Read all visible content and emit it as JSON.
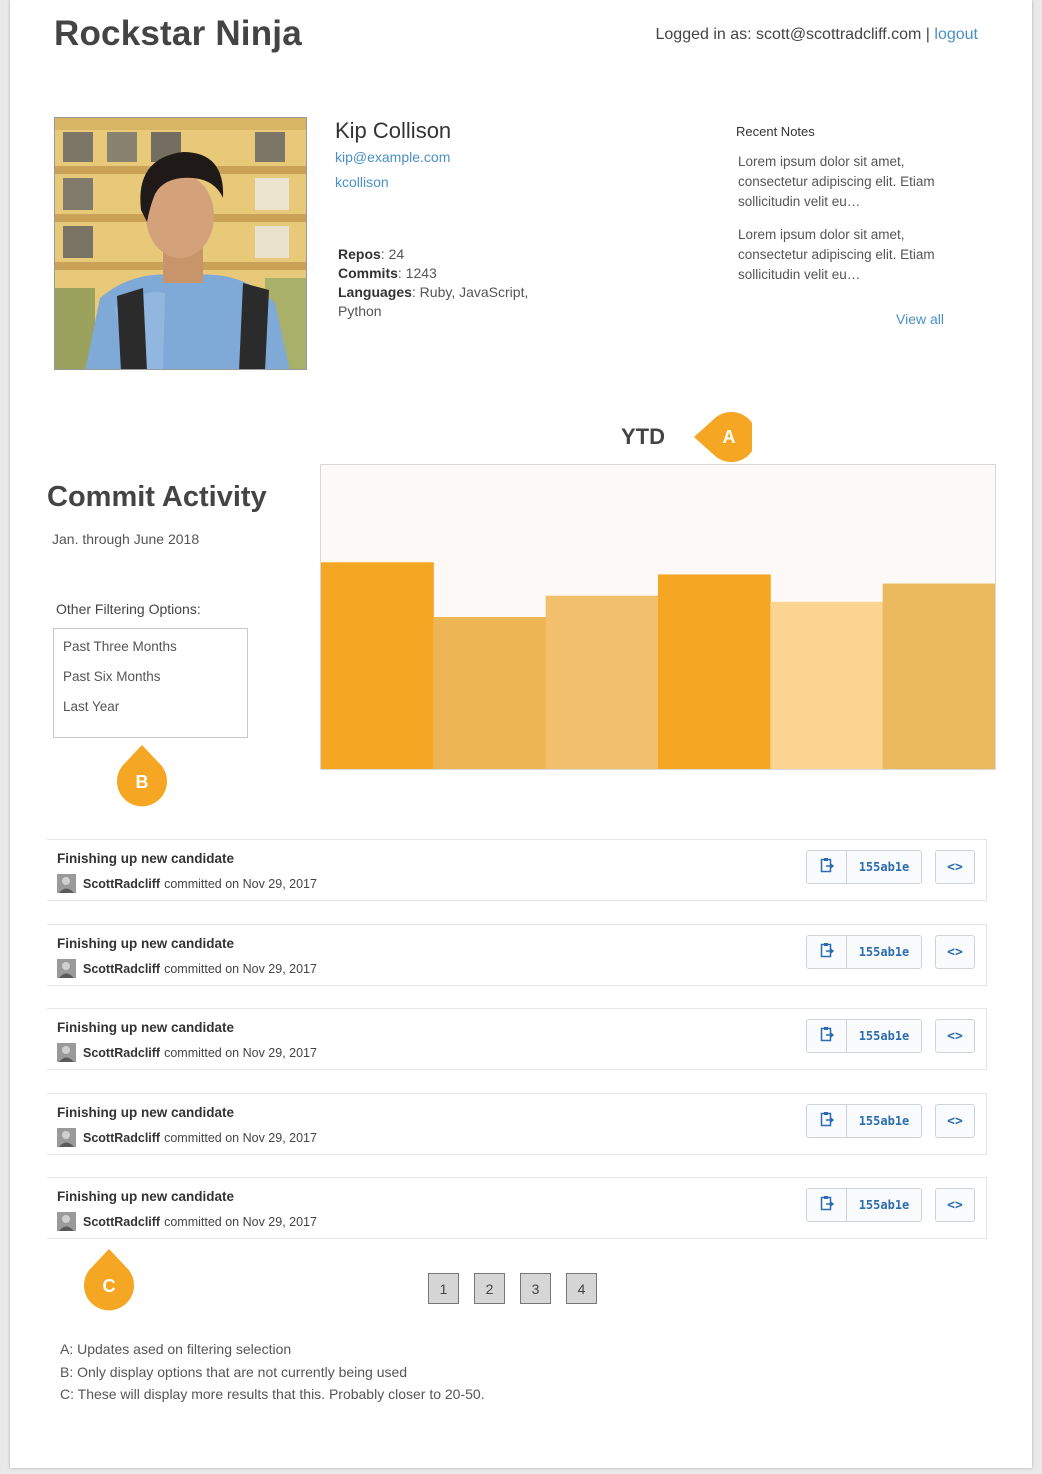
{
  "app": {
    "title": "Rockstar Ninja",
    "login_prefix": "Logged in as: scott@scottradcliff.com | ",
    "logout_label": "logout"
  },
  "profile": {
    "name": "Kip Collison",
    "email": "kip@example.com",
    "username": "kcollison",
    "repos_label": "Repos",
    "repos_value": ": 24",
    "commits_label": "Commits",
    "commits_value": ": 1243",
    "languages_label": "Languages",
    "languages_value": ": Ruby, JavaScript, Python"
  },
  "notes": {
    "title": "Recent Notes",
    "items": [
      "Lorem ipsum dolor sit amet, consectetur adipiscing elit. Etiam sollicitudin velit eu…",
      "Lorem ipsum dolor sit amet, consectetur adipiscing elit. Etiam sollicitudin velit eu…"
    ],
    "view_all_label": "View all"
  },
  "annotations": {
    "ytd_label": "YTD",
    "a": "A",
    "b": "B",
    "c": "C"
  },
  "activity": {
    "title": "Commit Activity",
    "subtitle": "Jan. through June 2018",
    "filter_title": "Other Filtering Options:",
    "filter_options": [
      "Past Three Months",
      "Past Six Months",
      "Last Year"
    ]
  },
  "chart_data": {
    "type": "bar",
    "title": "",
    "xlabel": "",
    "ylabel": "",
    "ylim": [
      0,
      100
    ],
    "grid": false,
    "categories": [
      "",
      "",
      "",
      "",
      "",
      ""
    ],
    "values": [
      68,
      50,
      57,
      64,
      55,
      61
    ],
    "colors": [
      "#f5a623",
      "#eeb554",
      "#f2c06c",
      "#f5a623",
      "#fcd491",
      "#ecba5e"
    ]
  },
  "commits": [
    {
      "title": "Finishing up new candidate",
      "author": "ScottRadcliff",
      "meta": "committed on Nov 29, 2017",
      "sha": "155ab1e",
      "browse": "<>"
    },
    {
      "title": "Finishing up new candidate",
      "author": "ScottRadcliff",
      "meta": "committed on Nov 29, 2017",
      "sha": "155ab1e",
      "browse": "<>"
    },
    {
      "title": "Finishing up new candidate",
      "author": "ScottRadcliff",
      "meta": "committed on Nov 29, 2017",
      "sha": "155ab1e",
      "browse": "<>"
    },
    {
      "title": "Finishing up new candidate",
      "author": "ScottRadcliff",
      "meta": "committed on Nov 29, 2017",
      "sha": "155ab1e",
      "browse": "<>"
    },
    {
      "title": "Finishing up new candidate",
      "author": "ScottRadcliff",
      "meta": "committed on Nov 29, 2017",
      "sha": "155ab1e",
      "browse": "<>"
    }
  ],
  "pagination": [
    "1",
    "2",
    "3",
    "4"
  ],
  "legend": [
    "A: Updates ased on filtering selection",
    "B: Only display options that are not currently being used",
    "C: These will display more results that this. Probably closer to 20-50."
  ],
  "colors": {
    "accent": "#f5a623",
    "link": "#4a90c8",
    "sha": "#2b6cb0"
  },
  "icons": {
    "copy": "clipboard-icon",
    "browse": "code-icon"
  }
}
